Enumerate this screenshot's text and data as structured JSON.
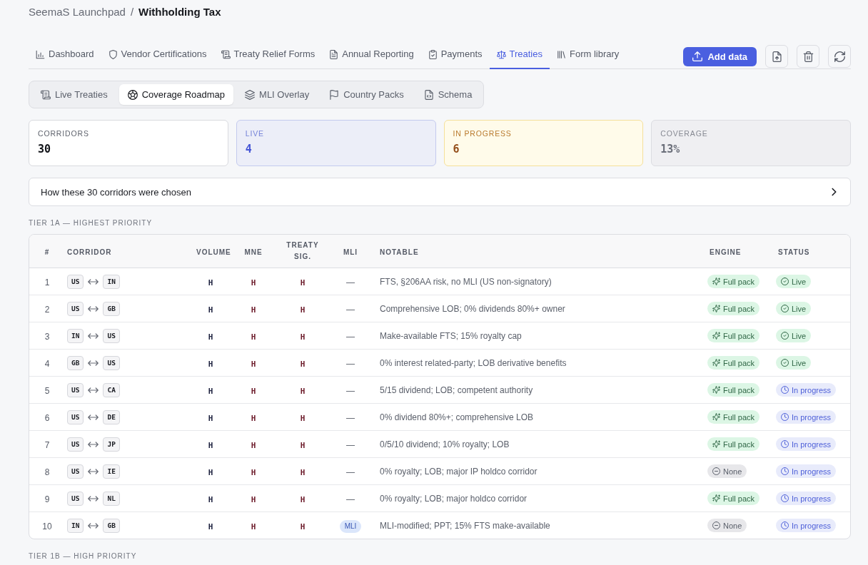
{
  "breadcrumb": {
    "parent": "SeemaS Launchpad",
    "separator": "/",
    "current": "Withholding Tax"
  },
  "tabs": [
    {
      "label": "Dashboard",
      "selected": false
    },
    {
      "label": "Vendor Certifications",
      "selected": false
    },
    {
      "label": "Treaty Relief Forms",
      "selected": false
    },
    {
      "label": "Annual Reporting",
      "selected": false
    },
    {
      "label": "Payments",
      "selected": false
    },
    {
      "label": "Treaties",
      "selected": true
    },
    {
      "label": "Form library",
      "selected": false
    }
  ],
  "toolbar": {
    "add_button": "Add data"
  },
  "subtabs": [
    {
      "label": "Live Treaties",
      "selected": false
    },
    {
      "label": "Coverage Roadmap",
      "selected": true
    },
    {
      "label": "MLI Overlay",
      "selected": false
    },
    {
      "label": "Country Packs",
      "selected": false
    },
    {
      "label": "Schema",
      "selected": false
    }
  ],
  "stats": [
    {
      "kind": "total",
      "label": "CORRIDORS",
      "value": "30"
    },
    {
      "kind": "live",
      "label": "LIVE",
      "value": "4"
    },
    {
      "kind": "progress",
      "label": "IN PROGRESS",
      "value": "6"
    },
    {
      "kind": "coverage",
      "label": "COVERAGE",
      "value": "13%"
    }
  ],
  "explainer": {
    "title": "How these 30 corridors were chosen",
    "expanded": false
  },
  "tiers": [
    {
      "title": "TIER 1A — HIGHEST PRIORITY",
      "columns": [
        "#",
        "CORRIDOR",
        "VOLUME",
        "MNE",
        "TREATY SIG.",
        "MLI",
        "NOTABLE",
        "ENGINE",
        "STATUS"
      ],
      "rows": [
        {
          "num": "1",
          "from": "US",
          "to": "IN",
          "volume": "H",
          "mne": "H",
          "treaty_sig": "H",
          "mli": {
            "kind": "none",
            "text": "—"
          },
          "notable": "FTS, §206AA risk, no MLI (US non-signatory)",
          "engine": {
            "kind": "full",
            "text": "Full pack"
          },
          "status": {
            "kind": "live",
            "text": "Live"
          }
        },
        {
          "num": "2",
          "from": "US",
          "to": "GB",
          "volume": "H",
          "mne": "H",
          "treaty_sig": "H",
          "mli": {
            "kind": "none",
            "text": "—"
          },
          "notable": "Comprehensive LOB; 0% dividends 80%+ owner",
          "engine": {
            "kind": "full",
            "text": "Full pack"
          },
          "status": {
            "kind": "live",
            "text": "Live"
          }
        },
        {
          "num": "3",
          "from": "IN",
          "to": "US",
          "volume": "H",
          "mne": "H",
          "treaty_sig": "H",
          "mli": {
            "kind": "none",
            "text": "—"
          },
          "notable": "Make-available FTS; 15% royalty cap",
          "engine": {
            "kind": "full",
            "text": "Full pack"
          },
          "status": {
            "kind": "live",
            "text": "Live"
          }
        },
        {
          "num": "4",
          "from": "GB",
          "to": "US",
          "volume": "H",
          "mne": "H",
          "treaty_sig": "H",
          "mli": {
            "kind": "none",
            "text": "—"
          },
          "notable": "0% interest related-party; LOB derivative benefits",
          "engine": {
            "kind": "full",
            "text": "Full pack"
          },
          "status": {
            "kind": "live",
            "text": "Live"
          }
        },
        {
          "num": "5",
          "from": "US",
          "to": "CA",
          "volume": "H",
          "mne": "H",
          "treaty_sig": "H",
          "mli": {
            "kind": "none",
            "text": "—"
          },
          "notable": "5/15 dividend; LOB; competent authority",
          "engine": {
            "kind": "full",
            "text": "Full pack"
          },
          "status": {
            "kind": "progress",
            "text": "In progress"
          }
        },
        {
          "num": "6",
          "from": "US",
          "to": "DE",
          "volume": "H",
          "mne": "H",
          "treaty_sig": "H",
          "mli": {
            "kind": "none",
            "text": "—"
          },
          "notable": "0% dividend 80%+; comprehensive LOB",
          "engine": {
            "kind": "full",
            "text": "Full pack"
          },
          "status": {
            "kind": "progress",
            "text": "In progress"
          }
        },
        {
          "num": "7",
          "from": "US",
          "to": "JP",
          "volume": "H",
          "mne": "H",
          "treaty_sig": "H",
          "mli": {
            "kind": "none",
            "text": "—"
          },
          "notable": "0/5/10 dividend; 10% royalty; LOB",
          "engine": {
            "kind": "full",
            "text": "Full pack"
          },
          "status": {
            "kind": "progress",
            "text": "In progress"
          }
        },
        {
          "num": "8",
          "from": "US",
          "to": "IE",
          "volume": "H",
          "mne": "H",
          "treaty_sig": "H",
          "mli": {
            "kind": "none",
            "text": "—"
          },
          "notable": "0% royalty; LOB; major IP holdco corridor",
          "engine": {
            "kind": "none",
            "text": "None"
          },
          "status": {
            "kind": "progress",
            "text": "In progress"
          }
        },
        {
          "num": "9",
          "from": "US",
          "to": "NL",
          "volume": "H",
          "mne": "H",
          "treaty_sig": "H",
          "mli": {
            "kind": "none",
            "text": "—"
          },
          "notable": "0% royalty; LOB; major holdco corridor",
          "engine": {
            "kind": "full",
            "text": "Full pack"
          },
          "status": {
            "kind": "progress",
            "text": "In progress"
          }
        },
        {
          "num": "10",
          "from": "IN",
          "to": "GB",
          "volume": "H",
          "mne": "H",
          "treaty_sig": "H",
          "mli": {
            "kind": "tag",
            "text": "MLI"
          },
          "notable": "MLI-modified; PPT; 15% FTS make-available",
          "engine": {
            "kind": "none",
            "text": "None"
          },
          "status": {
            "kind": "progress",
            "text": "In progress"
          }
        }
      ]
    },
    {
      "title": "TIER 1B — HIGH PRIORITY"
    }
  ]
}
